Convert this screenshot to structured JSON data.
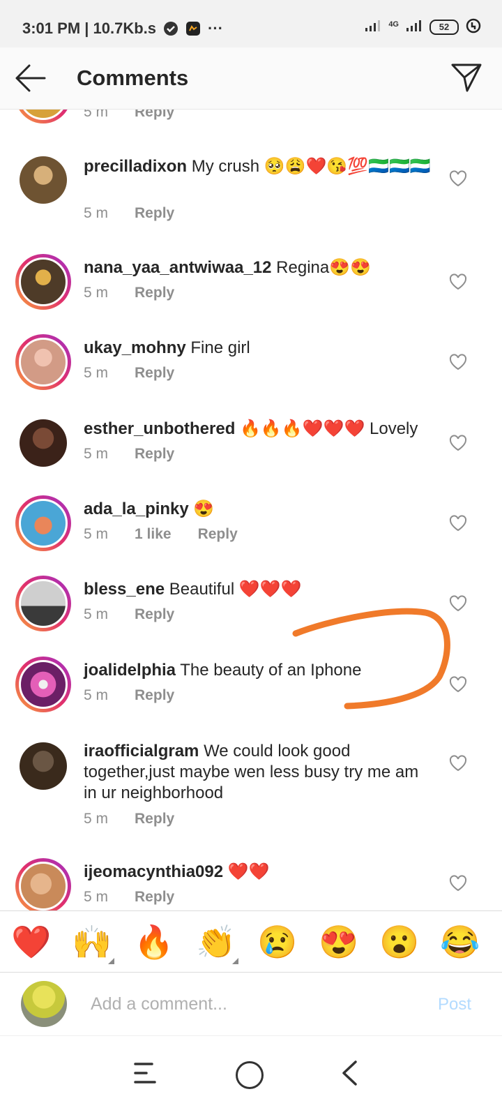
{
  "status_bar": {
    "time_speed": "3:01 PM | 10.7Kb.s",
    "overflow": "···",
    "network": "4G",
    "battery": "52"
  },
  "header": {
    "title": "Comments",
    "back_icon": "arrow-left-icon",
    "send_icon": "direct-send-icon"
  },
  "comments": [
    {
      "username": "",
      "text": "",
      "time": "5 m",
      "likes": "",
      "reply": "Reply",
      "avatar_color": "#d7a13a"
    },
    {
      "username": "precilladixon",
      "text": "My crush 🥺😩❤️😘💯🇸🇱🇸🇱🇸🇱",
      "time": "5 m",
      "likes": "",
      "reply": "Reply",
      "avatar_color": "#6e5332"
    },
    {
      "username": "nana_yaa_antwiwaa_12",
      "text": "Regina😍😍",
      "time": "5 m",
      "likes": "",
      "reply": "Reply",
      "avatar_color": "#4e3b28"
    },
    {
      "username": "ukay_mohny",
      "text": "Fine girl",
      "time": "5 m",
      "likes": "",
      "reply": "Reply",
      "avatar_color": "#d29b86"
    },
    {
      "username": "esther_unbothered",
      "text": "🔥🔥🔥❤️❤️❤️ Lovely",
      "time": "5 m",
      "likes": "",
      "reply": "Reply",
      "avatar_color": "#3b2219"
    },
    {
      "username": "ada_la_pinky",
      "text": "😍",
      "time": "5 m",
      "likes": "1 like",
      "reply": "Reply",
      "avatar_color": "#4aa6d6"
    },
    {
      "username": "bless_ene",
      "text": "Beautiful ❤️❤️❤️",
      "time": "5 m",
      "likes": "",
      "reply": "Reply",
      "avatar_color": "#9a9a9a"
    },
    {
      "username": "joalidelphia",
      "text": "The beauty of an Iphone",
      "time": "5 m",
      "likes": "",
      "reply": "Reply",
      "avatar_color": "#b83a9a"
    },
    {
      "username": "iraofficialgram",
      "text": "We could look good together,just maybe wen less busy try me am in ur neighborhood",
      "time": "5 m",
      "likes": "",
      "reply": "Reply",
      "avatar_color": "#3a2a1c"
    },
    {
      "username": "ijeomacynthia092",
      "text": "❤️❤️",
      "time": "5 m",
      "likes": "",
      "reply": "Reply",
      "avatar_color": "#c98a5a"
    }
  ],
  "emoji_bar": [
    "❤️",
    "🙌",
    "🔥",
    "👏",
    "😢",
    "😍",
    "😮",
    "😂"
  ],
  "comment_input": {
    "placeholder": "Add a comment...",
    "post_label": "Post"
  },
  "colors": {
    "post_disabled": "#b3dbff",
    "annotation": "#f07a2a",
    "username": "#262626",
    "meta": "#8e8e8e"
  }
}
